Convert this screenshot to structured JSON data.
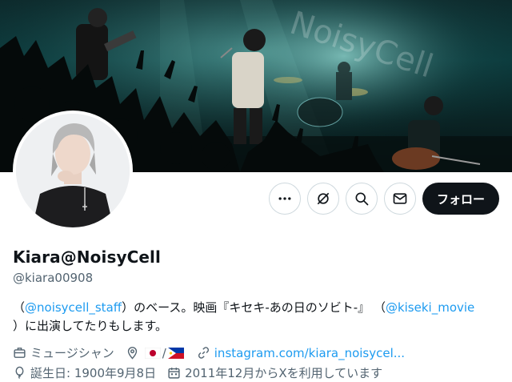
{
  "profile": {
    "display_name": "Kiara@NoisyCell",
    "handle": "@kiara00908",
    "banner_watermark": "NoisyCell"
  },
  "actions": {
    "more_icon": "more-icon",
    "grok_icon": "grok-icon",
    "search_icon": "search-icon",
    "message_icon": "envelope-icon",
    "follow_label": "フォロー"
  },
  "bio": {
    "open_paren_1": "（",
    "mention_1": "@noisycell_staff",
    "text_1": "）のベース。映画『キセキ-あの日のソビト-』 （",
    "mention_2": "@kiseki_movie",
    "text_2": "）に出演してたりもします。"
  },
  "meta": {
    "job": "ミュージシャン",
    "location_separator": "/",
    "location_flags": [
      "flag-japan",
      "flag-philippines"
    ],
    "website": "instagram.com/kiara_noisycel...",
    "birthday": "誕生日: 1900年9月8日",
    "joined": "2011年12月からXを利用しています"
  },
  "colors": {
    "accent": "#1d9bf0",
    "text_primary": "#0f1419",
    "text_secondary": "#536471",
    "follow_bg": "#0f1419",
    "border": "#cfd9de"
  }
}
